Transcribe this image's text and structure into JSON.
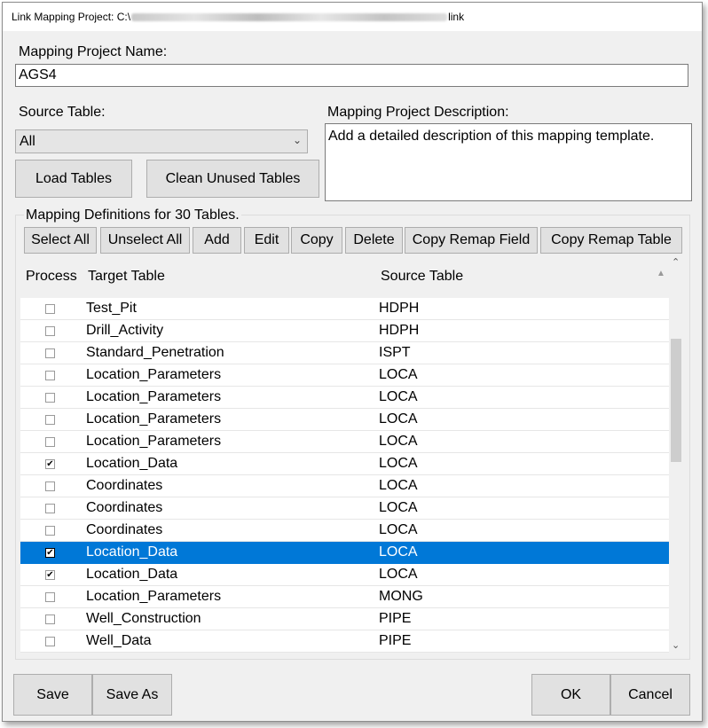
{
  "window": {
    "title_prefix": "Link Mapping Project: C:\\",
    "title_suffix": "link"
  },
  "project": {
    "name_label": "Mapping Project Name:",
    "name_value": "AGS4"
  },
  "source_table": {
    "label": "Source Table:",
    "selected": "All"
  },
  "description": {
    "label": "Mapping Project Description:",
    "value": "Add a detailed description of this mapping template."
  },
  "buttons": {
    "load_tables": "Load Tables",
    "clean_unused": "Clean Unused Tables",
    "save": "Save",
    "save_as": "Save As",
    "ok": "OK",
    "cancel": "Cancel"
  },
  "definitions": {
    "group_label": "Mapping Definitions for 30 Tables.",
    "toolbar": {
      "select_all": "Select All",
      "unselect_all": "Unselect All",
      "add": "Add",
      "edit": "Edit",
      "copy": "Copy",
      "delete": "Delete",
      "copy_remap_field": "Copy Remap Field",
      "copy_remap_table": "Copy Remap Table"
    },
    "columns": {
      "process": "Process",
      "target": "Target Table",
      "source": "Source Table"
    },
    "rows": [
      {
        "checked": false,
        "target": "Test_Pit",
        "source": "HDPH"
      },
      {
        "checked": false,
        "target": "Drill_Activity",
        "source": "HDPH"
      },
      {
        "checked": false,
        "target": "Standard_Penetration",
        "source": "ISPT"
      },
      {
        "checked": false,
        "target": "Location_Parameters",
        "source": "LOCA"
      },
      {
        "checked": false,
        "target": "Location_Parameters",
        "source": "LOCA"
      },
      {
        "checked": false,
        "target": "Location_Parameters",
        "source": "LOCA"
      },
      {
        "checked": false,
        "target": "Location_Parameters",
        "source": "LOCA"
      },
      {
        "checked": true,
        "target": "Location_Data",
        "source": "LOCA"
      },
      {
        "checked": false,
        "target": "Coordinates",
        "source": "LOCA"
      },
      {
        "checked": false,
        "target": "Coordinates",
        "source": "LOCA"
      },
      {
        "checked": false,
        "target": "Coordinates",
        "source": "LOCA"
      },
      {
        "checked": true,
        "target": "Location_Data",
        "source": "LOCA",
        "selected": true
      },
      {
        "checked": true,
        "target": "Location_Data",
        "source": "LOCA"
      },
      {
        "checked": false,
        "target": "Location_Parameters",
        "source": "MONG"
      },
      {
        "checked": false,
        "target": "Well_Construction",
        "source": "PIPE"
      },
      {
        "checked": false,
        "target": "Well_Data",
        "source": "PIPE"
      }
    ]
  },
  "colors": {
    "selection": "#0078d7"
  }
}
